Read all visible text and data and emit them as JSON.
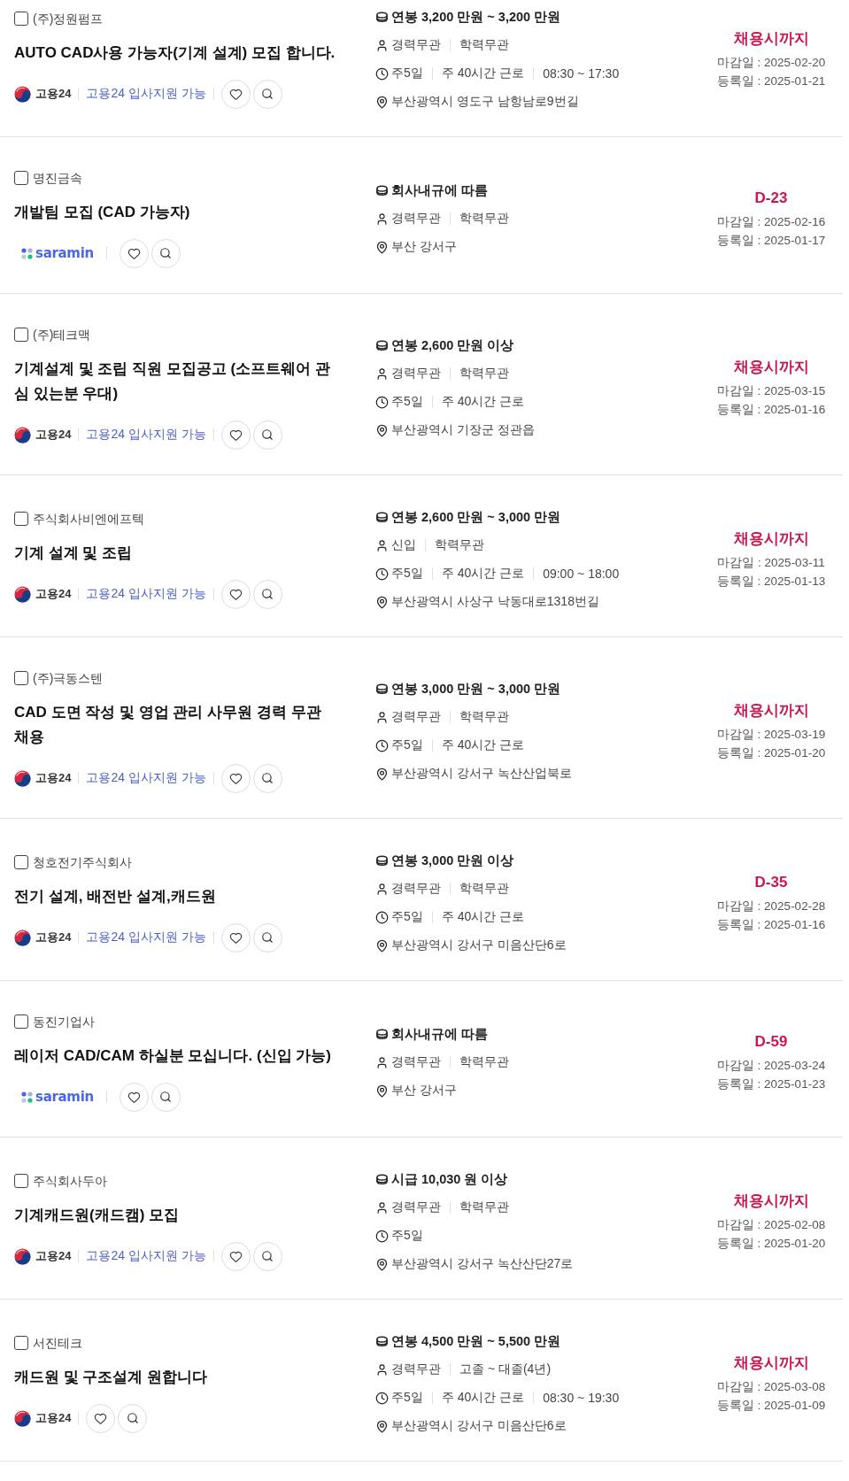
{
  "jobs": [
    {
      "company": "(주)정원펌프",
      "checked": false,
      "title": "AUTO CAD사용 가능자(기계 설계) 모집 합니다.",
      "source": {
        "kind": "work24",
        "name": "고용24",
        "apply": "고용24 입사지원 가능"
      },
      "salary": "연봉 3,200 만원 ~ 3,200 만원",
      "conditions": [
        "경력무관",
        "학력무관"
      ],
      "schedule": [
        "주5일",
        "주 40시간 근로",
        "08:30 ~ 17:30"
      ],
      "location": "부산광역시 영도구 남항남로9번길",
      "status": "채용시까지",
      "deadline": "마감일 : 2025-02-20",
      "registered": "등록일 : 2025-01-21"
    },
    {
      "company": "명진금속",
      "checked": false,
      "title": "개발팀 모집 (CAD 가능자)",
      "source": {
        "kind": "saramin",
        "name": "saramin"
      },
      "salary": "회사내규에 따름",
      "conditions": [
        "경력무관",
        "학력무관"
      ],
      "location": "부산 강서구",
      "status": "D-23",
      "deadline": "마감일 : 2025-02-16",
      "registered": "등록일 : 2025-01-17"
    },
    {
      "company": "(주)테크맥",
      "checked": false,
      "title": "기계설계 및 조립 직원 모집공고 (소프트웨어 관심 있는분 우대)",
      "source": {
        "kind": "work24",
        "name": "고용24",
        "apply": "고용24 입사지원 가능"
      },
      "salary": "연봉 2,600 만원 이상",
      "conditions": [
        "경력무관",
        "학력무관"
      ],
      "schedule": [
        "주5일",
        "주 40시간 근로"
      ],
      "location": "부산광역시 기장군 정관읍",
      "status": "채용시까지",
      "deadline": "마감일 : 2025-03-15",
      "registered": "등록일 : 2025-01-16"
    },
    {
      "company": "주식회사비엔에프텍",
      "checked": false,
      "title": "기계 설계 및 조립",
      "source": {
        "kind": "work24",
        "name": "고용24",
        "apply": "고용24 입사지원 가능"
      },
      "salary": "연봉 2,600 만원 ~ 3,000 만원",
      "conditions": [
        "신입",
        "학력무관"
      ],
      "schedule": [
        "주5일",
        "주 40시간 근로",
        "09:00 ~ 18:00"
      ],
      "location": "부산광역시 사상구 낙동대로1318번길",
      "status": "채용시까지",
      "deadline": "마감일 : 2025-03-11",
      "registered": "등록일 : 2025-01-13"
    },
    {
      "company": "(주)극동스텐",
      "checked": false,
      "title": "CAD 도면 작성 및 영업 관리 사무원 경력 무관 채용",
      "source": {
        "kind": "work24",
        "name": "고용24",
        "apply": "고용24 입사지원 가능"
      },
      "salary": "연봉 3,000 만원 ~ 3,000 만원",
      "conditions": [
        "경력무관",
        "학력무관"
      ],
      "schedule": [
        "주5일",
        "주 40시간 근로"
      ],
      "location": "부산광역시 강서구 녹산산업북로",
      "status": "채용시까지",
      "deadline": "마감일 : 2025-03-19",
      "registered": "등록일 : 2025-01-20"
    },
    {
      "company": "청호전기주식회사",
      "checked": false,
      "title": "전기 설계, 배전반 설계,캐드원",
      "source": {
        "kind": "work24",
        "name": "고용24",
        "apply": "고용24 입사지원 가능"
      },
      "salary": "연봉 3,000 만원 이상",
      "conditions": [
        "경력무관",
        "학력무관"
      ],
      "schedule": [
        "주5일",
        "주 40시간 근로"
      ],
      "location": "부산광역시 강서구 미음산단6로",
      "status": "D-35",
      "deadline": "마감일 : 2025-02-28",
      "registered": "등록일 : 2025-01-16"
    },
    {
      "company": "동진기업사",
      "checked": false,
      "title": "레이저 CAD/CAM 하실분 모십니다. (신입 가능)",
      "source": {
        "kind": "saramin",
        "name": "saramin"
      },
      "salary": "회사내규에 따름",
      "conditions": [
        "경력무관",
        "학력무관"
      ],
      "location": "부산 강서구",
      "status": "D-59",
      "deadline": "마감일 : 2025-03-24",
      "registered": "등록일 : 2025-01-23"
    },
    {
      "company": "주식회사두아",
      "checked": false,
      "title": "기계캐드원(캐드캠) 모집",
      "source": {
        "kind": "work24",
        "name": "고용24",
        "apply": "고용24 입사지원 가능"
      },
      "salary": "시급 10,030 원 이상",
      "conditions": [
        "경력무관",
        "학력무관"
      ],
      "schedule": [
        "주5일"
      ],
      "location": "부산광역시 강서구 녹산산단27로",
      "status": "채용시까지",
      "deadline": "마감일 : 2025-02-08",
      "registered": "등록일 : 2025-01-20"
    },
    {
      "company": "서진테크",
      "checked": false,
      "title": "캐드원 및 구조설계 원합니다",
      "source": {
        "kind": "work24",
        "name": "고용24"
      },
      "salary": "연봉 4,500 만원 ~ 5,500 만원",
      "conditions": [
        "경력무관",
        "고졸 ~ 대졸(4년)"
      ],
      "schedule": [
        "주5일",
        "주 40시간 근로",
        "08:30 ~ 19:30"
      ],
      "location": "부산광역시 강서구 미음산단6로",
      "status": "채용시까지",
      "deadline": "마감일 : 2025-03-08",
      "registered": "등록일 : 2025-01-09"
    }
  ]
}
